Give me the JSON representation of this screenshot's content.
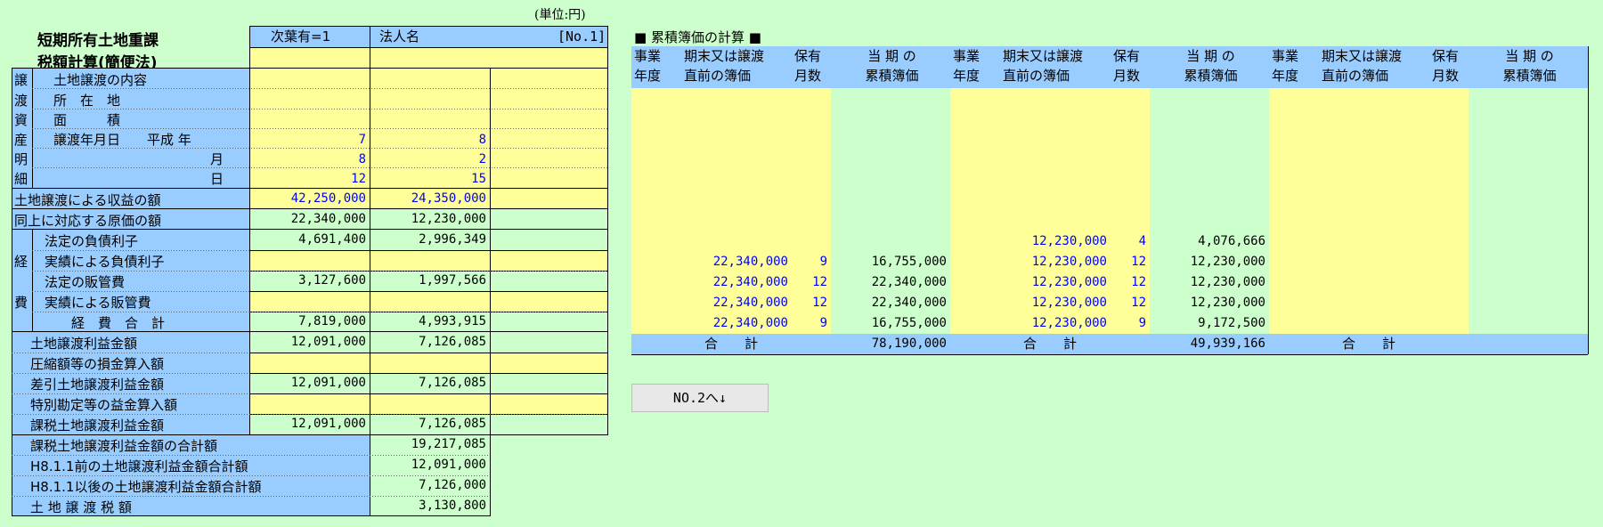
{
  "unit_label": "(単位:円)",
  "left": {
    "title_line1": "短期所有土地重課",
    "title_line2": "税額計算(簡便法)",
    "header_continuation": "次葉有=1",
    "header_company": "法人名",
    "header_page": "[No.1]",
    "side_chars": [
      "譲",
      "渡",
      "資",
      "産",
      "明",
      "細"
    ],
    "rows": {
      "naiyo": "土地譲渡の内容",
      "shozaichi": "所　在　地",
      "menseki": "面　　　積",
      "nen_label": "譲渡年月日　　平成 年",
      "tsuki_label": "月",
      "hi_label": "日"
    },
    "date_values": {
      "year": [
        "7",
        "8"
      ],
      "month": [
        "8",
        "2"
      ],
      "day": [
        "12",
        "15"
      ]
    },
    "shueki_label": "土地譲渡による収益の額",
    "shueki_values": [
      "42,250,000",
      "24,350,000"
    ],
    "genka_label": "同上に対応する原価の額",
    "genka_values": [
      "22,340,000",
      "12,230,000"
    ],
    "keihi_chars": [
      "経",
      "費"
    ],
    "hotei_fusai_label": "法定の負債利子",
    "hotei_fusai_values": [
      "4,691,400",
      "2,996,349"
    ],
    "jisseki_fusai_label": "実績による負債利子",
    "hotei_hankan_label": "法定の販管費",
    "hotei_hankan_values": [
      "3,127,600",
      "1,997,566"
    ],
    "jisseki_hankan_label": "実績による販管費",
    "keihi_gokei_label": "経　費　合　計",
    "keihi_gokei_values": [
      "7,819,000",
      "4,993,915"
    ],
    "rieki_label": "土地譲渡利益金額",
    "rieki_values": [
      "12,091,000",
      "7,126,085"
    ],
    "asshuku_label": "圧縮額等の損金算入額",
    "sabiki_label": "差引土地譲渡利益金額",
    "sabiki_values": [
      "12,091,000",
      "7,126,085"
    ],
    "tokubetsu_label": "特別勘定等の益金算入額",
    "kazei_label": "課税土地譲渡利益金額",
    "kazei_values": [
      "12,091,000",
      "7,126,085"
    ],
    "kazei_gokei_label": "課税土地譲渡利益金額の合計額",
    "kazei_gokei_value": "19,217,085",
    "mae_label": "H8.1.1前の土地譲渡利益金額合計額",
    "mae_value": "12,091,000",
    "go_label": "H8.1.1以後の土地譲渡利益金額合計額",
    "go_value": "7,126,000",
    "zeigaku_label": "土 地 譲 渡 税 額",
    "zeigaku_value": "3,130,800"
  },
  "right": {
    "title": "■ 累積簿価の計算 ■",
    "col_headers": {
      "nendo": [
        "事業",
        "年度"
      ],
      "boka": [
        "期末又は譲渡",
        "直前の簿価"
      ],
      "tsuki": [
        "保有",
        "月数"
      ],
      "ruiseki": [
        "当 期 の",
        "累積簿価"
      ]
    },
    "group1_rows": [
      {
        "boka": "",
        "tsuki": "",
        "ruiseki": ""
      },
      {
        "boka": "",
        "tsuki": "",
        "ruiseki": ""
      },
      {
        "boka": "",
        "tsuki": "",
        "ruiseki": ""
      },
      {
        "boka": "",
        "tsuki": "",
        "ruiseki": ""
      },
      {
        "boka": "",
        "tsuki": "",
        "ruiseki": ""
      },
      {
        "boka": "",
        "tsuki": "",
        "ruiseki": ""
      },
      {
        "boka": "",
        "tsuki": "",
        "ruiseki": ""
      },
      {
        "boka": "",
        "tsuki": "",
        "ruiseki": ""
      },
      {
        "boka": "22,340,000",
        "tsuki": "9",
        "ruiseki": "16,755,000"
      },
      {
        "boka": "22,340,000",
        "tsuki": "12",
        "ruiseki": "22,340,000"
      },
      {
        "boka": "22,340,000",
        "tsuki": "12",
        "ruiseki": "22,340,000"
      },
      {
        "boka": "22,340,000",
        "tsuki": "9",
        "ruiseki": "16,755,000"
      }
    ],
    "group2_rows": [
      {
        "boka": "",
        "tsuki": "",
        "ruiseki": ""
      },
      {
        "boka": "",
        "tsuki": "",
        "ruiseki": ""
      },
      {
        "boka": "",
        "tsuki": "",
        "ruiseki": ""
      },
      {
        "boka": "",
        "tsuki": "",
        "ruiseki": ""
      },
      {
        "boka": "",
        "tsuki": "",
        "ruiseki": ""
      },
      {
        "boka": "",
        "tsuki": "",
        "ruiseki": ""
      },
      {
        "boka": "",
        "tsuki": "",
        "ruiseki": ""
      },
      {
        "boka": "12,230,000",
        "tsuki": "4",
        "ruiseki": "4,076,666"
      },
      {
        "boka": "12,230,000",
        "tsuki": "12",
        "ruiseki": "12,230,000"
      },
      {
        "boka": "12,230,000",
        "tsuki": "12",
        "ruiseki": "12,230,000"
      },
      {
        "boka": "12,230,000",
        "tsuki": "12",
        "ruiseki": "12,230,000"
      },
      {
        "boka": "12,230,000",
        "tsuki": "9",
        "ruiseki": "9,172,500"
      }
    ],
    "gokei_label": "合　　計",
    "gokei_values": [
      "78,190,000",
      "49,939,166",
      ""
    ]
  },
  "button_label": "NO.2へ↓"
}
